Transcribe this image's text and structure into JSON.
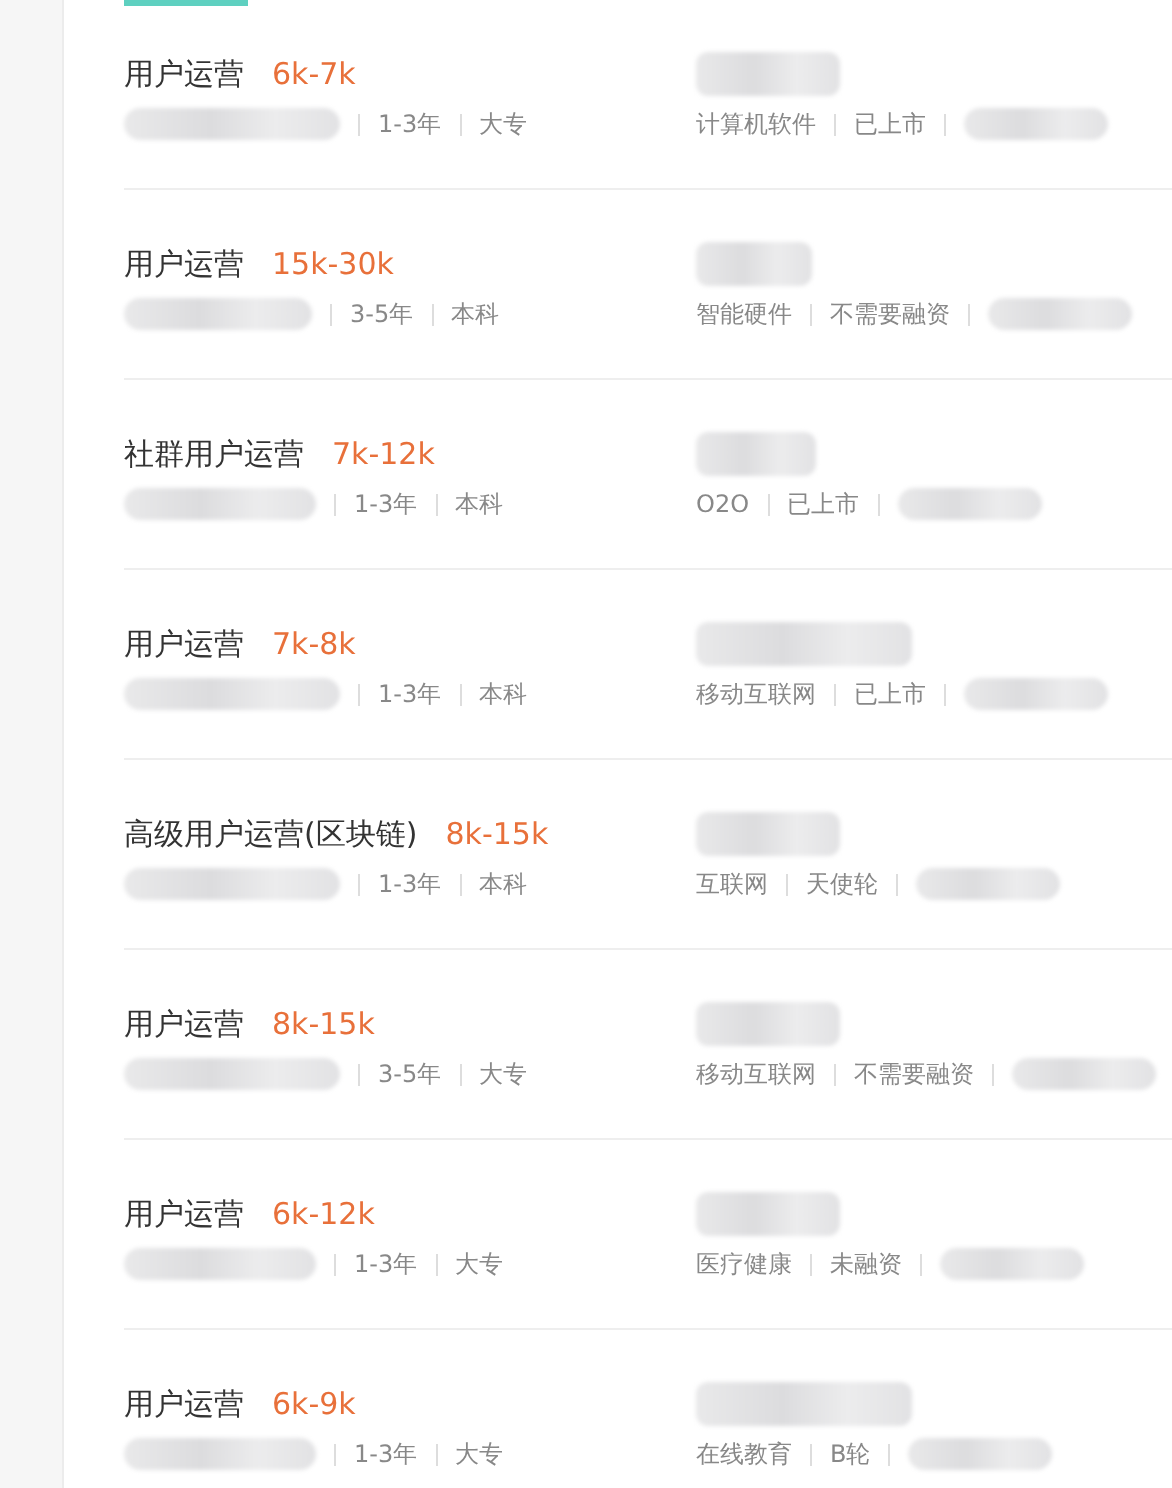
{
  "jobs": [
    {
      "title": "用户运营",
      "salary": "6k-7k",
      "experience": "1-3年",
      "education": "大专",
      "industry": "计算机软件",
      "funding": "已上市"
    },
    {
      "title": "用户运营",
      "salary": "15k-30k",
      "experience": "3-5年",
      "education": "本科",
      "industry": "智能硬件",
      "funding": "不需要融资"
    },
    {
      "title": "社群用户运营",
      "salary": "7k-12k",
      "experience": "1-3年",
      "education": "本科",
      "industry": "O2O",
      "funding": "已上市"
    },
    {
      "title": "用户运营",
      "salary": "7k-8k",
      "experience": "1-3年",
      "education": "本科",
      "industry": "移动互联网",
      "funding": "已上市"
    },
    {
      "title": "高级用户运营(区块链)",
      "salary": "8k-15k",
      "experience": "1-3年",
      "education": "本科",
      "industry": "互联网",
      "funding": "天使轮"
    },
    {
      "title": "用户运营",
      "salary": "8k-15k",
      "experience": "3-5年",
      "education": "大专",
      "industry": "移动互联网",
      "funding": "不需要融资"
    },
    {
      "title": "用户运营",
      "salary": "6k-12k",
      "experience": "1-3年",
      "education": "大专",
      "industry": "医疗健康",
      "funding": "未融资"
    },
    {
      "title": "用户运营",
      "salary": "6k-9k",
      "experience": "1-3年",
      "education": "大专",
      "industry": "在线教育",
      "funding": "B轮"
    }
  ]
}
